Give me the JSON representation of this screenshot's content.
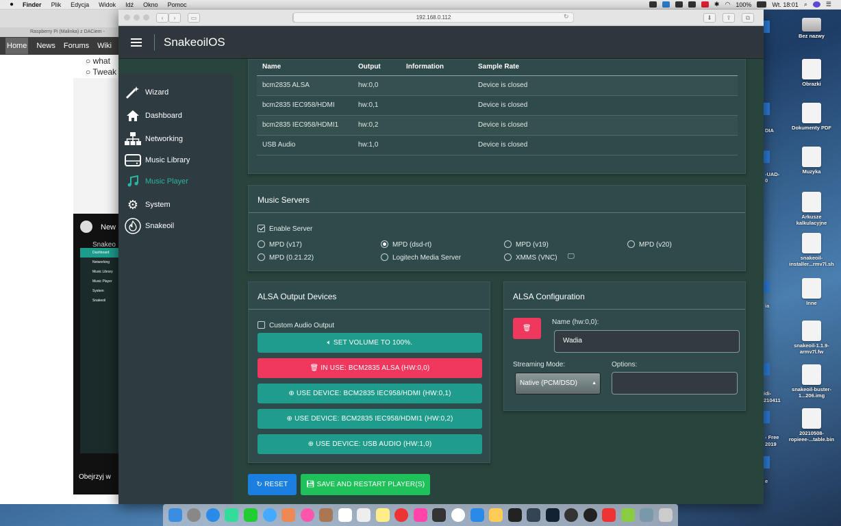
{
  "menubar": {
    "items": [
      "Finder",
      "Plik",
      "Edycja",
      "Widok",
      "Idź",
      "Okno",
      "Pomoc"
    ],
    "battery": "100%",
    "clock": "Wt. 18:01"
  },
  "desktop": {
    "icons": [
      "Bez nazwy",
      "Obrazki",
      "Dokumenty PDF",
      "Muzyka",
      "Arkusze kalkulacyjne",
      "snakeoil-installer...rmv7l.sh",
      "Inne",
      "snakeoil-1.1.9-armv7l.fw",
      "snakeoil-buster-1...206.img",
      "20210508-ropieee-...table.bin"
    ],
    "edge_labels": [
      "DIA",
      "-UAD-",
      "0",
      "ia",
      "idi-",
      "210411",
      "- Free",
      "2019",
      "e"
    ]
  },
  "bg_browser": {
    "tab_title": "Raspberry Pi (Malinka) z DACiem -",
    "nav": [
      "Home",
      "News",
      "Forums",
      "Wiki"
    ],
    "bullets": [
      "what",
      "Tweak"
    ],
    "video_brand": "Snakeo",
    "video_items": [
      "Dashboard",
      "Networking",
      "Music Library",
      "Music Player",
      "System",
      "Snakeoil"
    ],
    "video_new": "New",
    "video_footer": "Obejrzyj w"
  },
  "browser": {
    "url": "192.168.0.112"
  },
  "app": {
    "brand": "SnakeoilOS"
  },
  "sidebar": {
    "items": [
      {
        "label": "Wizard",
        "icon": "wand-icon"
      },
      {
        "label": "Dashboard",
        "icon": "home-icon"
      },
      {
        "label": "Networking",
        "icon": "network-icon"
      },
      {
        "label": "Music Library",
        "icon": "drive-icon"
      },
      {
        "label": "Music Player",
        "icon": "music-note-icon"
      },
      {
        "label": "System",
        "icon": "gear-icon"
      },
      {
        "label": "Snakeoil",
        "icon": "flame-icon"
      }
    ],
    "active": "Music Player"
  },
  "devices": {
    "headers": [
      "Name",
      "Output",
      "Information",
      "Sample Rate"
    ],
    "rows": [
      {
        "name": "bcm2835 ALSA",
        "output": "hw:0,0",
        "info": "",
        "rate": "Device is closed"
      },
      {
        "name": "bcm2835 IEC958/HDMI",
        "output": "hw:0,1",
        "info": "",
        "rate": "Device is closed"
      },
      {
        "name": "bcm2835 IEC958/HDMI1",
        "output": "hw:0,2",
        "info": "",
        "rate": "Device is closed"
      },
      {
        "name": "USB Audio",
        "output": "hw:1,0",
        "info": "",
        "rate": "Device is closed"
      }
    ]
  },
  "music_servers": {
    "title": "Music Servers",
    "enable_label": "Enable Server",
    "enabled": true,
    "options": [
      "MPD (v17)",
      "MPD (dsd-rt)",
      "MPD (v19)",
      "MPD (v20)",
      "MPD (0.21.22)",
      "Logitech Media Server",
      "XMMS (VNC)"
    ],
    "selected": "MPD (dsd-rt)"
  },
  "alsa_output": {
    "title": "ALSA Output Devices",
    "custom_label": "Custom Audio Output",
    "buttons": [
      "SET VOLUME TO 100%.",
      "IN USE: BCM2835 ALSA (HW:0,0)",
      "USE DEVICE: BCM2835 IEC958/HDMI (HW:0,1)",
      "USE DEVICE: BCM2835 IEC958/HDMI1 (HW:0,2)",
      "USE DEVICE: USB AUDIO (HW:1,0)"
    ]
  },
  "alsa_config": {
    "title": "ALSA Configuration",
    "name_label": "Name (hw:0,0):",
    "name_value": "Wadia",
    "streaming_label": "Streaming Mode:",
    "streaming_value": "Native (PCM/DSD)",
    "options_label": "Options:",
    "options_value": ""
  },
  "footer_buttons": {
    "reset": "RESET",
    "save": "SAVE AND RESTART PLAYER(S)"
  },
  "colors": {
    "accent_teal": "#1f9c8c",
    "danger_pink": "#f0385e",
    "reset_blue": "#1a7fe0",
    "save_green": "#1ec15a"
  }
}
